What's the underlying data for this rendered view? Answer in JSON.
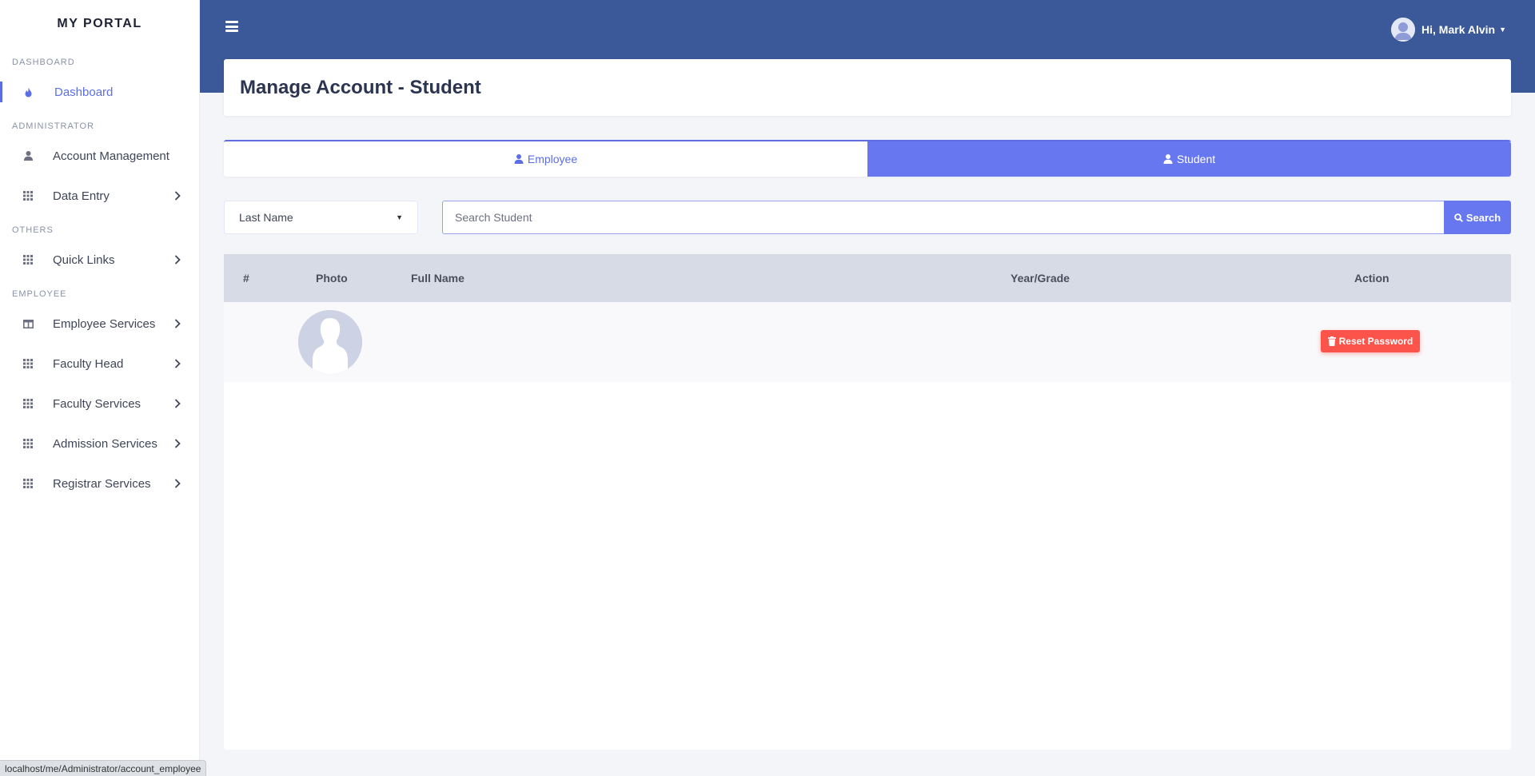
{
  "brand": "MY PORTAL",
  "sidebar": {
    "sections": [
      {
        "heading": "DASHBOARD"
      },
      {
        "heading": "ADMINISTRATOR"
      },
      {
        "heading": "OTHERS"
      },
      {
        "heading": "EMPLOYEE"
      }
    ],
    "items": [
      {
        "label": "Dashboard",
        "icon": "fire-icon"
      },
      {
        "label": "Account Management",
        "icon": "user-icon"
      },
      {
        "label": "Data Entry",
        "icon": "grid-icon"
      },
      {
        "label": "Quick Links",
        "icon": "grid-icon"
      },
      {
        "label": "Employee Services",
        "icon": "columns-icon"
      },
      {
        "label": "Faculty Head",
        "icon": "grid-icon"
      },
      {
        "label": "Faculty Services",
        "icon": "grid-icon"
      },
      {
        "label": "Admission Services",
        "icon": "grid-icon"
      },
      {
        "label": "Registrar Services",
        "icon": "grid-icon"
      }
    ]
  },
  "topbar": {
    "user_greeting": "Hi, Mark Alvin"
  },
  "page": {
    "title": "Manage Account - Student"
  },
  "tabs": {
    "employee": "Employee",
    "student": "Student"
  },
  "filter": {
    "selected": "Last Name",
    "search_placeholder": "Search Student",
    "search_label": "Search"
  },
  "table": {
    "headers": {
      "num": "#",
      "photo": "Photo",
      "full_name": "Full Name",
      "year_grade": "Year/Grade",
      "action": "Action"
    },
    "rows": [
      {
        "num": "",
        "full_name": "",
        "year_grade": "",
        "action_label": "Reset Password"
      }
    ]
  },
  "status_url": "localhost/me/Administrator/account_employee",
  "colors": {
    "primary": "#6777ef",
    "topbar": "#3b5998",
    "danger": "#fc544b"
  }
}
